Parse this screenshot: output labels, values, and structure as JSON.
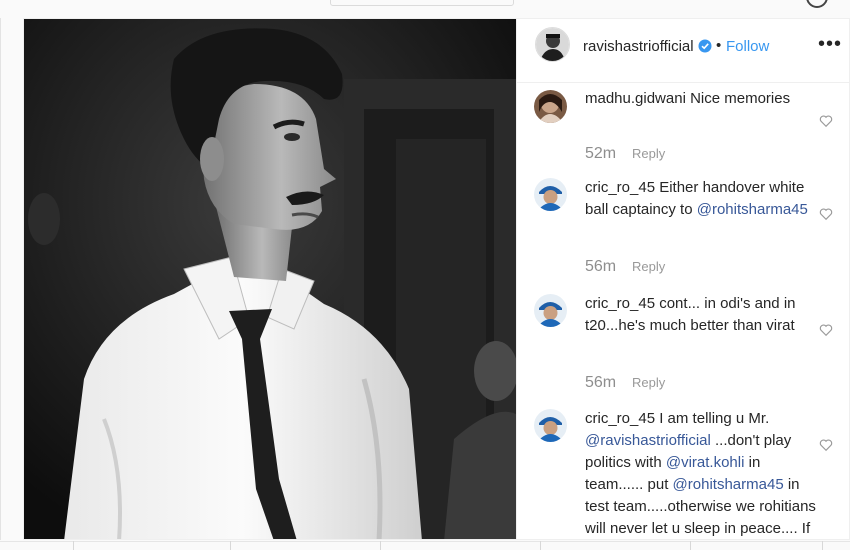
{
  "post": {
    "author": "ravishastriofficial",
    "separator": "•",
    "follow_label": "Follow",
    "more_label": "•••"
  },
  "comments": [
    {
      "user": "madhu.gidwani",
      "text": " Nice memories",
      "time": "52m",
      "reply_label": "Reply"
    },
    {
      "user": "cric_ro_45",
      "text_before": " Either handover white ball captaincy to ",
      "mention": "@rohitsharma45",
      "time": "56m",
      "reply_label": "Reply"
    },
    {
      "user": "cric_ro_45",
      "text": " cont... in odi's and in t20...he's much better than virat",
      "time": "56m",
      "reply_label": "Reply"
    },
    {
      "user": "cric_ro_45",
      "text_1": " I am telling u Mr. ",
      "mention_1": "@ravishastriofficial",
      "text_2": " ...don't play politics with ",
      "mention_2": "@virat.kohli",
      "text_3": " in team...... put ",
      "mention_3": "@rohitsharma45",
      "text_4": " in test team.....otherwise we rohitians will never let u sleep in peace.... If"
    }
  ],
  "icons": {
    "verified": "verified-badge-icon",
    "heart": "heart-outline-icon",
    "more": "more-options-icon"
  },
  "colors": {
    "follow": "#3897f0",
    "mention": "#385898",
    "verified": "#3897f0",
    "muted": "#8e8e8e"
  }
}
